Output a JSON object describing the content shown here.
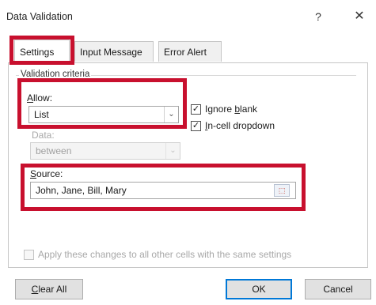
{
  "window": {
    "title": "Data Validation",
    "help_label": "?",
    "close_label": "✕"
  },
  "tabs": [
    {
      "label": "Settings",
      "active": true
    },
    {
      "label": "Input Message",
      "active": false
    },
    {
      "label": "Error Alert",
      "active": false
    }
  ],
  "criteria": {
    "group_caption": "Validation criteria",
    "allow": {
      "label_prefix": "",
      "label_underlined": "A",
      "label_rest": "llow:",
      "value": "List"
    },
    "data": {
      "label": "Data:",
      "value": "between",
      "disabled": true
    },
    "ignore_blank": {
      "label_prefix": "Ignore ",
      "label_underlined": "b",
      "label_rest": "lank",
      "checked": true,
      "check_glyph": "✓"
    },
    "in_cell_dropdown": {
      "label_prefix": "",
      "label_underlined": "I",
      "label_rest": "n-cell dropdown",
      "checked": true,
      "check_glyph": "✓"
    },
    "source": {
      "label_prefix": "",
      "label_underlined": "S",
      "label_rest": "ource:",
      "value": "John, Jane, Bill, Mary",
      "ref_button_glyph": "⬚"
    },
    "apply_all": {
      "label": "Apply these changes to all other cells with the same settings",
      "checked": false,
      "disabled": true
    }
  },
  "buttons": {
    "clear_all_prefix": "",
    "clear_all_underlined": "C",
    "clear_all_rest": "lear All",
    "ok": "OK",
    "cancel": "Cancel"
  },
  "dropdown_arrow": "⌄",
  "colors": {
    "highlight": "#c8102e",
    "default_button_border": "#0078d7"
  }
}
